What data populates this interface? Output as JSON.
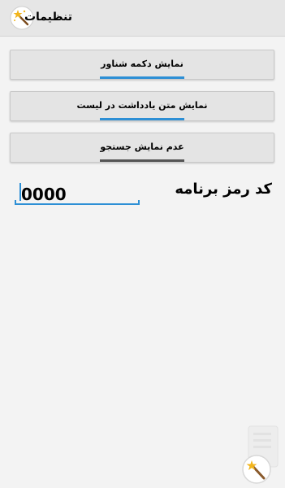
{
  "app_bar": {
    "title": "تنظیمات",
    "icon": "magic-wand-icon"
  },
  "buttons": [
    {
      "label": "نمایش دکمه شناور",
      "active": true
    },
    {
      "label": "نمایش متن یادداشت در لیست",
      "active": true
    },
    {
      "label": "عدم نمایش جستجو",
      "active": false
    }
  ],
  "password": {
    "label": "کد رمز برنامه",
    "value": "0000"
  },
  "colors": {
    "accent": "#2d8fd5",
    "inactive": "#555555",
    "app_bar": "#e6e6e6",
    "background": "#f3f3f3"
  },
  "watermark": {
    "icon": "note-pad-logo-icon"
  }
}
